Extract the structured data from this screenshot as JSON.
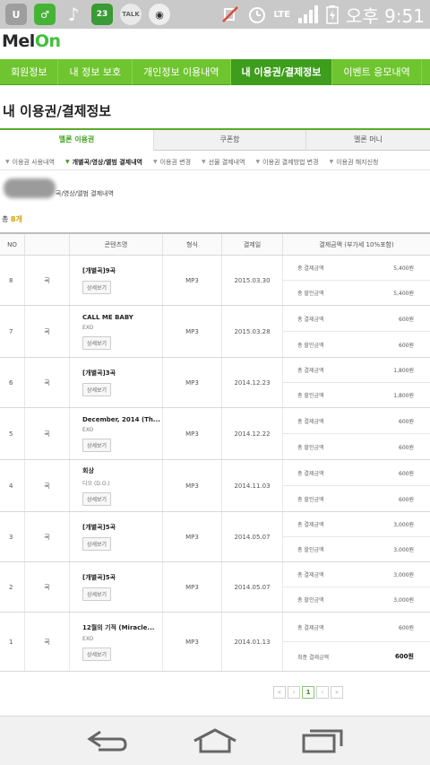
{
  "status_bar": {
    "talk_label": "TALK",
    "lte_label": "LTE",
    "time": "오후 9:51"
  },
  "logo": {
    "text_a": "Mel",
    "text_b": "On"
  },
  "nav": {
    "items": [
      {
        "label": "회원정보"
      },
      {
        "label": "내 정보 보호"
      },
      {
        "label": "개인정보 이용내역"
      },
      {
        "label": "내 이용권/결제정보"
      },
      {
        "label": "이벤트 응모내역"
      }
    ]
  },
  "page_title": "내 이용권/결제정보",
  "tabs": [
    {
      "label": "멜론 이용권"
    },
    {
      "label": "쿠폰함"
    },
    {
      "label": "멜론 머니"
    }
  ],
  "subfilters": [
    {
      "label": "이용권 사용내역"
    },
    {
      "label": "개별곡/영상/앨범 결제내역"
    },
    {
      "label": "이용권 변경"
    },
    {
      "label": "선물 결제내역"
    },
    {
      "label": "이용권 결제방법 변경"
    },
    {
      "label": "이용권 해지신청"
    }
  ],
  "description": "곡/영상/앨범 결제내역",
  "count": {
    "prefix": "총",
    "value": "8개"
  },
  "table": {
    "headers": {
      "no": "NO",
      "content": "콘텐츠명",
      "format": "형식",
      "date": "결제일",
      "payment": "결제금액 (부가세 10%포함)"
    },
    "detail_label": "상세보기",
    "rows": [
      {
        "no": "8",
        "type": "곡",
        "title": "[개별곡]9곡",
        "artist": "",
        "format": "MP3",
        "date": "2015.03.30",
        "line1_label": "총 결제금액",
        "line1_amt": "5,400원",
        "line2_label": "총 할인금액",
        "line2_amt": "5,400원"
      },
      {
        "no": "7",
        "type": "곡",
        "title": "CALL ME BABY",
        "artist": "EXO",
        "format": "MP3",
        "date": "2015.03.28",
        "line1_label": "총 결제금액",
        "line1_amt": "600원",
        "line2_label": "총 할인금액",
        "line2_amt": "600원"
      },
      {
        "no": "6",
        "type": "곡",
        "title": "[개별곡]3곡",
        "artist": "",
        "format": "MP3",
        "date": "2014.12.23",
        "line1_label": "총 결제금액",
        "line1_amt": "1,800원",
        "line2_label": "총 할인금액",
        "line2_amt": "1,800원"
      },
      {
        "no": "5",
        "type": "곡",
        "title": "December, 2014 (Th...",
        "artist": "EXO",
        "format": "MP3",
        "date": "2014.12.22",
        "line1_label": "총 결제금액",
        "line1_amt": "600원",
        "line2_label": "총 할인금액",
        "line2_amt": "600원"
      },
      {
        "no": "4",
        "type": "곡",
        "title": "회상",
        "artist": "디오 (D.O.)",
        "format": "MP3",
        "date": "2014.11.03",
        "line1_label": "총 결제금액",
        "line1_amt": "600원",
        "line2_label": "총 할인금액",
        "line2_amt": "600원"
      },
      {
        "no": "3",
        "type": "곡",
        "title": "[개별곡]5곡",
        "artist": "",
        "format": "MP3",
        "date": "2014.05.07",
        "line1_label": "총 결제금액",
        "line1_amt": "3,000원",
        "line2_label": "총 할인금액",
        "line2_amt": "3,000원"
      },
      {
        "no": "2",
        "type": "곡",
        "title": "[개별곡]5곡",
        "artist": "",
        "format": "MP3",
        "date": "2014.05.07",
        "line1_label": "총 결제금액",
        "line1_amt": "3,000원",
        "line2_label": "총 할인금액",
        "line2_amt": "3,000원"
      },
      {
        "no": "1",
        "type": "곡",
        "title": "12월의 기적 (Miracle...",
        "artist": "EXO",
        "format": "MP3",
        "date": "2014.01.13",
        "line1_label": "총 결제금액",
        "line1_amt": "600원",
        "line2_label": "최종 결제금액",
        "line2_amt": "600원"
      }
    ]
  },
  "pager": {
    "first": "«",
    "prev": "‹",
    "current": "1",
    "next": "›",
    "last": "»"
  },
  "colors": {
    "brand_green": "#6fc52f",
    "active_nav": "#3e9d1c",
    "count_gold": "#d8a000"
  },
  "icons": [
    "phone-dial-icon",
    "green-app-icon",
    "music-note-icon",
    "calendar-icon",
    "talk-icon",
    "ghost-icon",
    "mute-icon",
    "alarm-icon",
    "signal-icon",
    "battery-icon",
    "back-icon",
    "home-icon",
    "recent-apps-icon"
  ]
}
